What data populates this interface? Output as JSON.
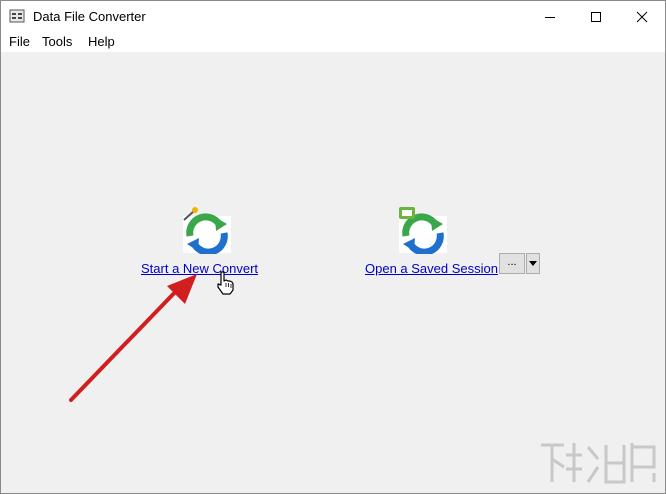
{
  "window": {
    "title": "Data File Converter",
    "controls": [
      "minimize",
      "maximize",
      "close"
    ]
  },
  "menu": {
    "items": [
      "File",
      "Tools",
      "Help"
    ]
  },
  "actions": {
    "new_convert_label": "Start a New Convert",
    "open_session_label": "Open a Saved Session",
    "browse_label": "..."
  },
  "icons": {
    "app": "data-file-converter-icon",
    "new_convert": "refresh-with-wand-icon",
    "open_session": "refresh-with-folder-icon",
    "cursor": "hand-pointer-icon",
    "dropdown": "dropdown-arrow-icon"
  },
  "colors": {
    "link": "#0000cc",
    "annotation_arrow": "#d11e1e",
    "refresh_green": "#3aa84a",
    "refresh_blue": "#1f6fcf"
  }
}
